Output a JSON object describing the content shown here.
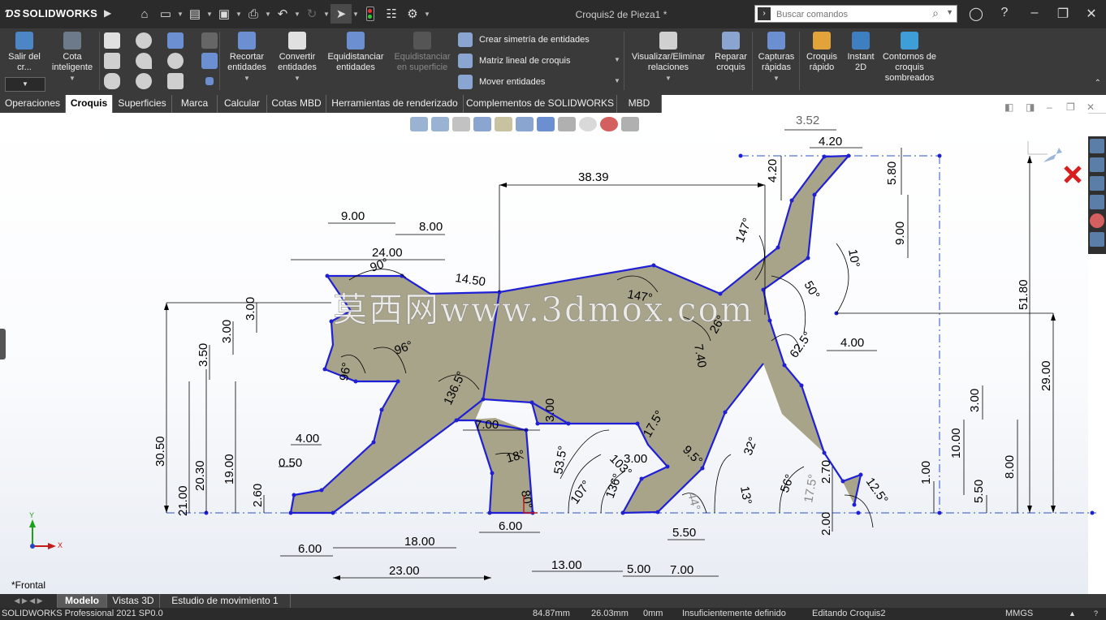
{
  "titlebar": {
    "brand": "SOLIDWORKS",
    "window_title": "Croquis2 de Pieza1 *",
    "search_placeholder": "Buscar comandos"
  },
  "ribbon": {
    "exit_sketch": "Salir del cr...",
    "smart_dimension": "Cota inteligente",
    "trim": "Recortar entidades",
    "convert": "Convertir entidades",
    "offset": "Equidistanciar entidades",
    "offset_surface": "Equidistanciar en superficie",
    "mirror": "Crear simetría de entidades",
    "linear_pattern": "Matriz lineal de croquis",
    "move": "Mover entidades",
    "relations": "Visualizar/Eliminar relaciones",
    "repair": "Reparar croquis",
    "quick_snaps": "Capturas rápidas",
    "rapid_sketch": "Croquis rápido",
    "instant2d": "Instant 2D",
    "shaded_contours": "Contornos de croquis sombreados"
  },
  "tabs": [
    "Operaciones",
    "Croquis",
    "Superficies",
    "Marca",
    "Calcular",
    "Cotas MBD",
    "Herramientas de renderizado",
    "Complementos de SOLIDWORKS",
    "MBD"
  ],
  "active_tab": "Croquis",
  "canvas": {
    "view_name": "*Frontal",
    "watermark": "莫西网www.3dmox.com",
    "dimensions": [
      "3.52",
      "4.20",
      "4.20",
      "5.80",
      "9.00",
      "38.39",
      "9.00",
      "8.00",
      "24.00",
      "14.50",
      "3.00",
      "3.00",
      "3.50",
      "51.80",
      "29.00",
      "4.00",
      "3.00",
      "10.00",
      "8.00",
      "1.00",
      "5.50",
      "2.70",
      "2.00",
      "30.50",
      "21.00",
      "20.30",
      "19.00",
      "2.60",
      "0.50",
      "4.00",
      "6.00",
      "18.00",
      "23.00",
      "6.00",
      "13.00",
      "5.00",
      "7.00",
      "5.50",
      "3.00",
      "7.00",
      "7.40",
      "3.00"
    ],
    "angles": [
      "90°",
      "147°",
      "147°",
      "10°",
      "50°",
      "26°",
      "62.5°",
      "96°",
      "96°",
      "136.5°",
      "53.5°",
      "107°",
      "103°",
      "136°",
      "17.5°",
      "9.5°",
      "18°",
      "80°",
      "44°",
      "13°",
      "32°",
      "56°",
      "17.5°",
      "12.5°"
    ],
    "axis_y": "Y",
    "axis_x": "X"
  },
  "bottom_tabs": [
    "Modelo",
    "Vistas 3D",
    "Estudio de movimiento 1"
  ],
  "status": {
    "product": "SOLIDWORKS Professional 2021 SP0.0",
    "x": "84.87mm",
    "y": "26.03mm",
    "z": "0mm",
    "state": "Insuficientemente definido",
    "editing": "Editando Croquis2",
    "units": "MMGS"
  },
  "colors": {
    "sketch_line": "#1f1fd6",
    "fill": "#a8a48a",
    "ribbon": "#3a3a3a",
    "titlebar": "#2b2b2b"
  }
}
